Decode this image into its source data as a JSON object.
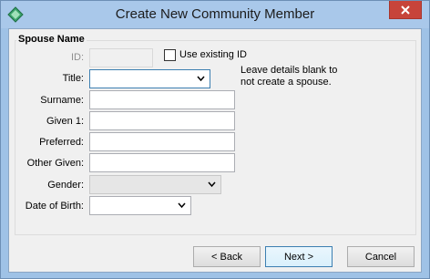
{
  "window": {
    "title": "Create New Community Member",
    "app_icon": "app-diamond-icon",
    "close_icon": "close-icon"
  },
  "group": {
    "title": "Spouse Name",
    "note": "Leave details blank to not create a spouse."
  },
  "fields": {
    "id": {
      "label": "ID:",
      "value": ""
    },
    "use_existing": {
      "label": "Use existing ID",
      "checked": false
    },
    "title": {
      "label": "Title:",
      "value": ""
    },
    "surname": {
      "label": "Surname:",
      "value": ""
    },
    "given1": {
      "label": "Given 1:",
      "value": ""
    },
    "preferred": {
      "label": "Preferred:",
      "value": ""
    },
    "other_given": {
      "label": "Other Given:",
      "value": ""
    },
    "gender": {
      "label": "Gender:",
      "value": ""
    },
    "dob": {
      "label": "Date of Birth:",
      "value": ""
    }
  },
  "buttons": {
    "back": "< Back",
    "next": "Next >",
    "cancel": "Cancel"
  },
  "colors": {
    "titlebar": "#a9c8ea",
    "close": "#c7443a",
    "focus_border": "#3c7fb1"
  }
}
